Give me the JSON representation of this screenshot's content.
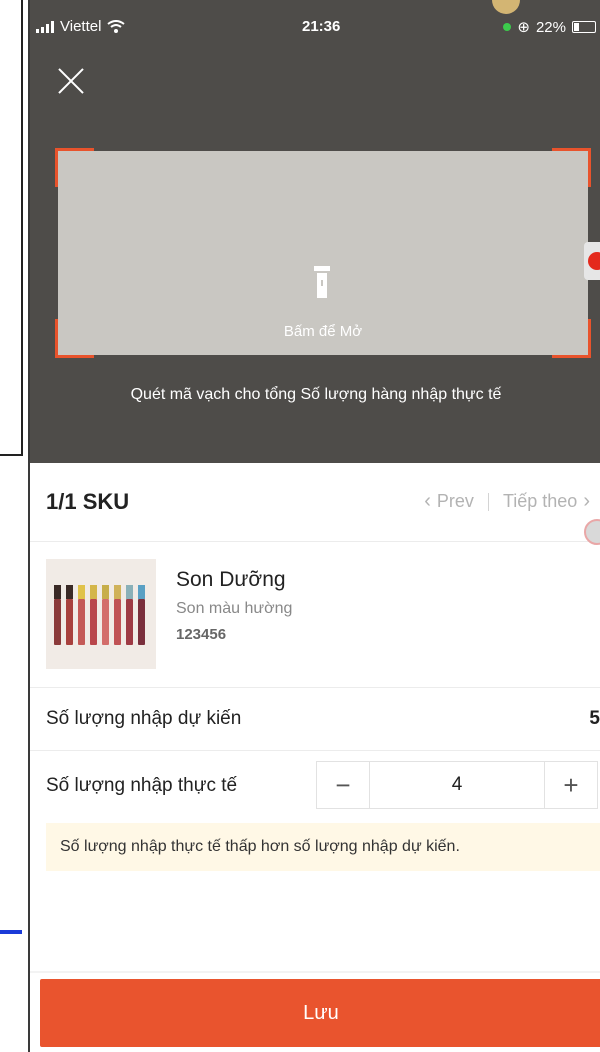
{
  "status_bar": {
    "carrier": "Viettel",
    "time": "21:36",
    "battery": "22%"
  },
  "scanner": {
    "torch_label": "Bấm để Mở",
    "hint": "Quét mã vạch cho tổng Số lượng hàng nhập thực tế"
  },
  "sku_header": {
    "count": "1/1 SKU",
    "prev_label": "Prev",
    "next_label": "Tiếp theo"
  },
  "product": {
    "name": "Son Dưỡng",
    "variant": "Son màu hường",
    "code": "123456"
  },
  "expected": {
    "label": "Số lượng nhập dự kiến",
    "value": "5"
  },
  "actual": {
    "label": "Số lượng nhập thực tế",
    "value": "4",
    "minus": "−",
    "plus": "+"
  },
  "warning": "Số lượng nhập thực tế thấp hơn số lượng nhập dự kiến.",
  "save_label": "Lưu",
  "colors": {
    "accent": "#e9542e",
    "warning_bg": "#fff8e6",
    "camera_bg": "#4e4c49"
  }
}
